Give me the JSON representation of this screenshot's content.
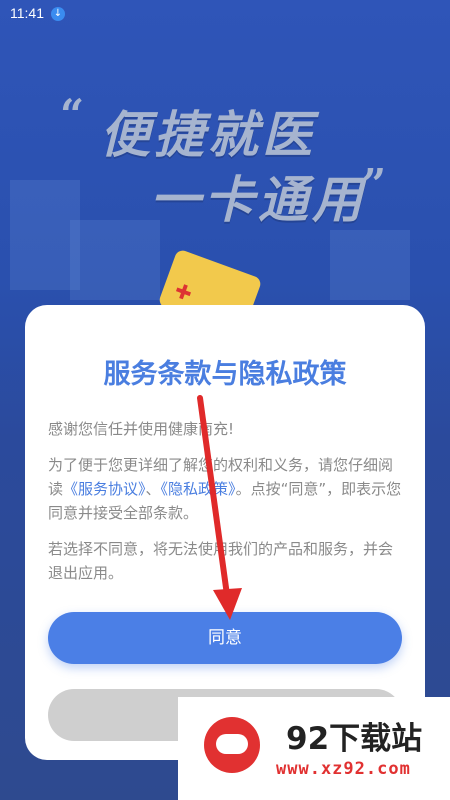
{
  "status_bar": {
    "time": "11:41",
    "download_icon": "download-icon"
  },
  "background": {
    "slogan_line1": "便捷就医",
    "slogan_line2": "一卡通用",
    "quote_open": "“",
    "quote_close": "”"
  },
  "dialog": {
    "title": "服务条款与隐私政策",
    "para1": "感谢您信任并使用健康南充!",
    "para2_before": "为了便于您更详细了解您的权利和义务，请您仔细阅读",
    "service_link": "《服务协议》",
    "separator": "、",
    "privacy_link": "《隐私政策》",
    "para2_after": "。点按“同意”，即表示您同意并接受全部条款。",
    "para3": "若选择不同意，将无法使用我们的产品和服务，并会退出应用。",
    "agree_label": "同意",
    "disagree_label": ""
  },
  "watermark": {
    "name": "92下载站",
    "url": "www.xz92.com"
  },
  "colors": {
    "accent": "#4b7fe6",
    "background": "#2a4ea8",
    "arrow": "#e02a2a"
  }
}
